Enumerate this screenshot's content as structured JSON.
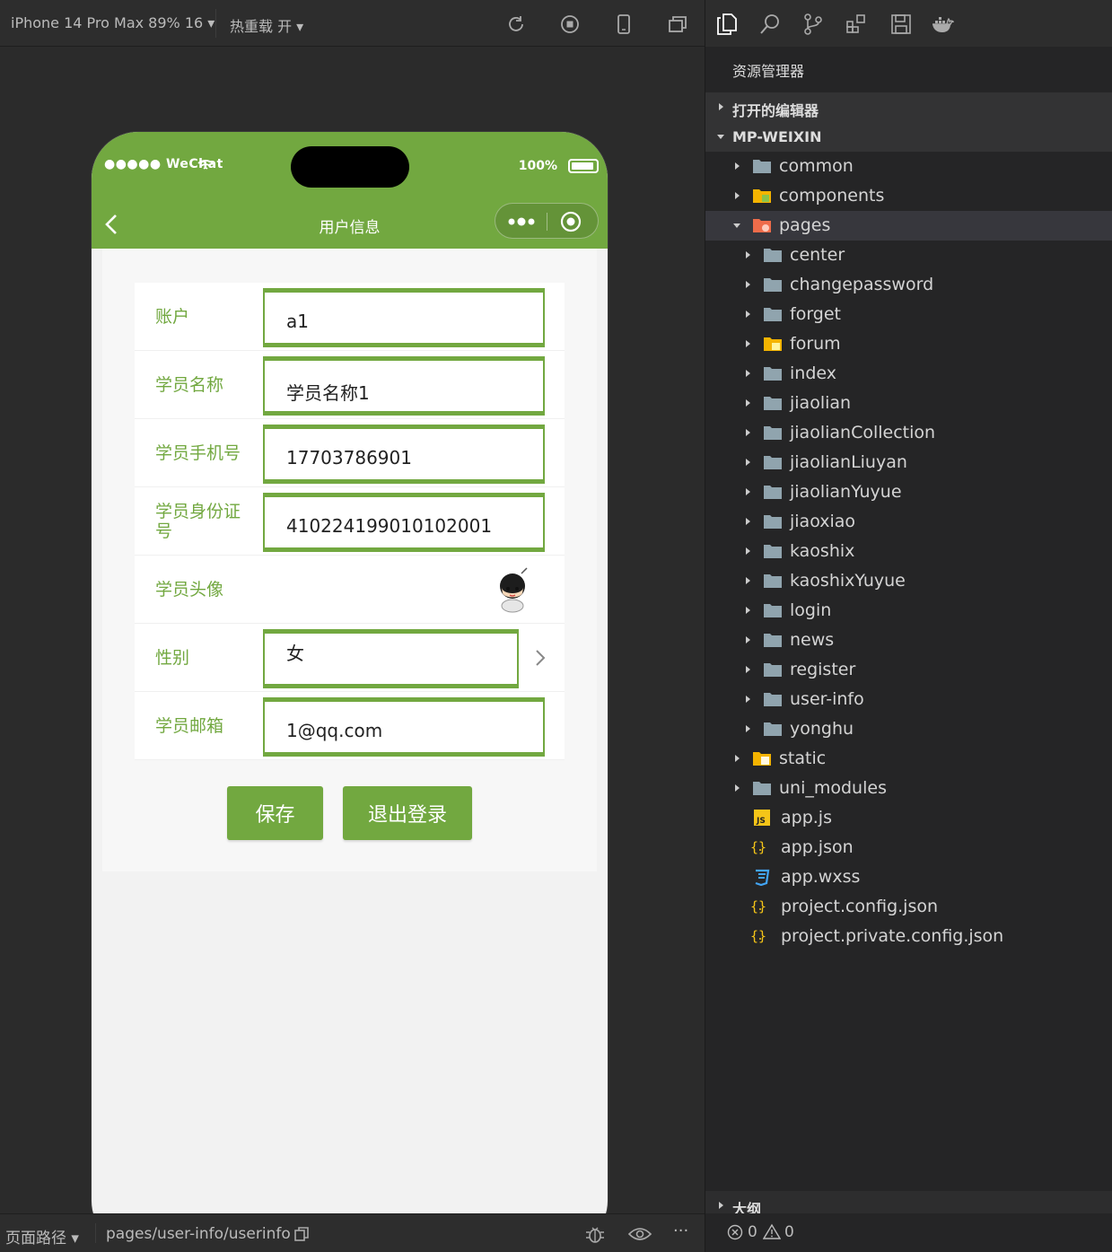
{
  "toolbar": {
    "device": "iPhone 14 Pro Max 89% 16",
    "hot_reload": "热重载 开"
  },
  "phone": {
    "status_left": "●●●●● WeChat",
    "battery": "100%",
    "nav_title": "用户信息"
  },
  "form": {
    "rows": [
      {
        "label": "账户",
        "value": "a1"
      },
      {
        "label": "学员名称",
        "value": "学员名称1"
      },
      {
        "label": "学员手机号",
        "value": "17703786901"
      },
      {
        "label": "学员身份证号",
        "value": "410224199010102001"
      },
      {
        "label": "学员头像",
        "value": ""
      },
      {
        "label": "性别",
        "value": "女"
      },
      {
        "label": "学员邮箱",
        "value": "1@qq.com"
      }
    ],
    "save_label": "保存",
    "logout_label": "退出登录"
  },
  "bottom": {
    "path_label": "页面路径",
    "path": "pages/user-info/userinfo",
    "errors": "0",
    "warnings": "0"
  },
  "explorer": {
    "title": "资源管理器",
    "open_editors": "打开的编辑器",
    "project": "MP-WEIXIN",
    "outline": "大纲",
    "tree": [
      {
        "name": "common",
        "type": "folder"
      },
      {
        "name": "components",
        "type": "folder-special"
      },
      {
        "name": "pages",
        "type": "folder-open"
      },
      {
        "name": "center",
        "type": "folder"
      },
      {
        "name": "changepassword",
        "type": "folder"
      },
      {
        "name": "forget",
        "type": "folder"
      },
      {
        "name": "forum",
        "type": "folder-special"
      },
      {
        "name": "index",
        "type": "folder"
      },
      {
        "name": "jiaolian",
        "type": "folder"
      },
      {
        "name": "jiaolianCollection",
        "type": "folder"
      },
      {
        "name": "jiaolianLiuyan",
        "type": "folder"
      },
      {
        "name": "jiaolianYuyue",
        "type": "folder"
      },
      {
        "name": "jiaoxiao",
        "type": "folder"
      },
      {
        "name": "kaoshix",
        "type": "folder"
      },
      {
        "name": "kaoshixYuyue",
        "type": "folder"
      },
      {
        "name": "login",
        "type": "folder"
      },
      {
        "name": "news",
        "type": "folder"
      },
      {
        "name": "register",
        "type": "folder"
      },
      {
        "name": "user-info",
        "type": "folder"
      },
      {
        "name": "yonghu",
        "type": "folder"
      },
      {
        "name": "static",
        "type": "folder-special"
      },
      {
        "name": "uni_modules",
        "type": "folder"
      },
      {
        "name": "app.js",
        "type": "js"
      },
      {
        "name": "app.json",
        "type": "json"
      },
      {
        "name": "app.wxss",
        "type": "css"
      },
      {
        "name": "project.config.json",
        "type": "json"
      },
      {
        "name": "project.private.config.json",
        "type": "json"
      }
    ]
  },
  "colors": {
    "brand_green": "#72a840",
    "folder": "#90a4ae",
    "folder_special": "#f4b400",
    "pages_folder": "#ef6c4a"
  }
}
